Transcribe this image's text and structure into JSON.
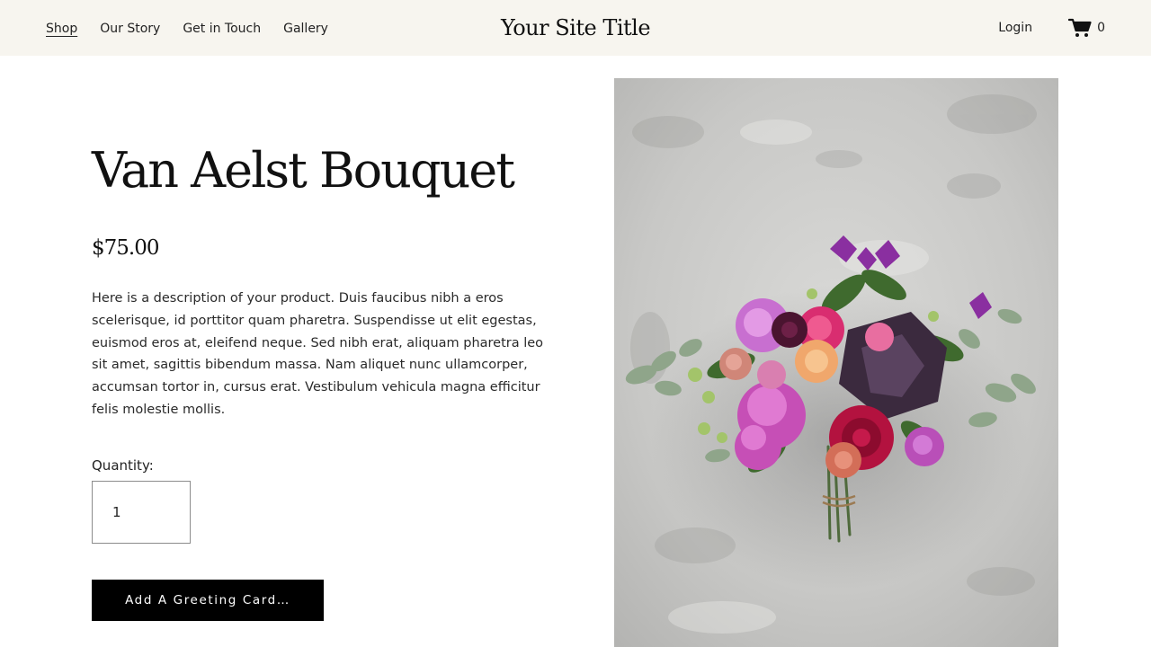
{
  "header": {
    "nav": [
      {
        "label": "Shop",
        "active": true
      },
      {
        "label": "Our Story",
        "active": false
      },
      {
        "label": "Get in Touch",
        "active": false
      },
      {
        "label": "Gallery",
        "active": false
      }
    ],
    "site_title": "Your Site Title",
    "login_label": "Login",
    "cart_count": "0",
    "cart_icon": "cart-icon"
  },
  "product": {
    "title": "Van Aelst Bouquet",
    "price": "$75.00",
    "description": "Here is a description of your product. Duis faucibus nibh a eros scelerisque, id porttitor quam pharetra. Suspendisse ut elit egestas, euismod eros at, eleifend neque. Sed nibh erat, aliquam pharetra leo sit amet, sagittis bibendum massa. Nam aliquet nunc ullamcorper, accumsan tortor in, cursus erat. Vestibulum vehicula magna efficitur felis molestie mollis.",
    "quantity_label": "Quantity:",
    "quantity_value": "1",
    "greeting_button_label": "Add A Greeting Card…",
    "image_subject": "flower bouquet on grey concrete"
  },
  "colors": {
    "header_bg": "#f7f5ef",
    "button_bg": "#000000",
    "button_text": "#ffffff",
    "text": "#1a1a1a"
  }
}
